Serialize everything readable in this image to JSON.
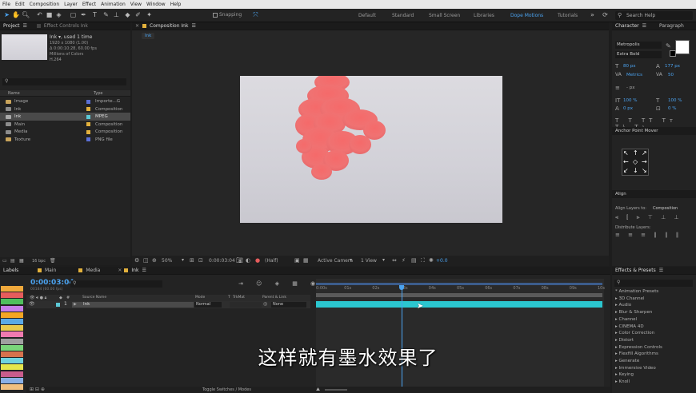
{
  "menu": [
    "File",
    "Edit",
    "Composition",
    "Layer",
    "Effect",
    "Animation",
    "View",
    "Window",
    "Help"
  ],
  "toolbar": {
    "snapping_label": "Snapping",
    "workspaces": [
      "Default",
      "Standard",
      "Small Screen",
      "Libraries",
      "Dope Motions",
      "Tutorials"
    ],
    "active_workspace": "Dope Motions",
    "search_placeholder": "Search Help"
  },
  "project": {
    "tab_label": "Project",
    "effect_controls_tab": "Effect Controls Ink",
    "selected_name": "Ink ▾, used 1 time",
    "info_lines": [
      "1920 x 1080 (1.00)",
      "Δ 0:00:10:28, 60.00 fps",
      "Millions of Colors",
      "H.264"
    ],
    "header_name": "Name",
    "header_type": "Type",
    "items": [
      {
        "name": "Image",
        "type": "Importe...G",
        "color": "#5a6fd6",
        "icon": "folder-icon",
        "icon_color": "#c9a45b"
      },
      {
        "name": "Ink",
        "type": "Composition",
        "color": "#e3b13c",
        "icon": "composition-icon",
        "icon_color": "#8c8c8c"
      },
      {
        "name": "Ink",
        "type": "MPEG",
        "color": "#5dc9d6",
        "icon": "video-icon",
        "icon_color": "#aaaaaa",
        "selected": true
      },
      {
        "name": "Main",
        "type": "Composition",
        "color": "#e3b13c",
        "icon": "composition-icon",
        "icon_color": "#8c8c8c"
      },
      {
        "name": "Media",
        "type": "Composition",
        "color": "#e3b13c",
        "icon": "composition-icon",
        "icon_color": "#8c8c8c"
      },
      {
        "name": "Texture",
        "type": "PNG file",
        "color": "#5a6fd6",
        "icon": "image-icon",
        "icon_color": "#c9a45b"
      }
    ],
    "bpc": "16 bpc"
  },
  "viewer": {
    "tab_label": "Composition Ink",
    "sub_tab": "Ink",
    "zoom": "50%",
    "timecode": "0:00:03:04",
    "resolution": "(Half)",
    "camera": "Active Camera",
    "views": "1 View",
    "exposure": "+0.0"
  },
  "character": {
    "tab_label": "Character",
    "paragraph_tab": "Paragraph",
    "font": "Metropolis",
    "style": "Extra Bold",
    "size": "80 px",
    "leading": "177 px",
    "kerning": "Metrics",
    "tracking": "50",
    "stroke_width": "- px",
    "vscale": "100 %",
    "hscale": "100 %",
    "baseline": "0 px",
    "tsume": "0 %",
    "anchor_title": "Anchor Point Mover",
    "align_tab": "Align",
    "align_to_label": "Align Layers to:",
    "align_to_value": "Composition",
    "distribute_label": "Distribute Layers:"
  },
  "effects": {
    "tab_label": "Effects & Presets",
    "items": [
      "* Animation Presets",
      "▸ 3D Channel",
      "▸ Audio",
      "▸ Blur & Sharpen",
      "▸ Channel",
      "▸ CINEMA 4D",
      "▸ Color Correction",
      "▸ Distort",
      "▸ Expression Controls",
      "▸ Flexfill Algorithms",
      "▸ Generate",
      "▸ Immersive Video",
      "▸ Keying",
      "▸ Knoll"
    ]
  },
  "labels": {
    "tab_label": "Labels",
    "swatches": [
      "#f0a93c",
      "#e65c5c",
      "#4fbf5c",
      "#c77de8",
      "#f5a623",
      "#5aa9e6",
      "#e8c94d",
      "#f07ab0",
      "#a0a0a0",
      "#7ad67a",
      "#d6724d",
      "#6fd3e0",
      "#e6e64d",
      "#c95c8c",
      "#8ab0e6",
      "#f0c080"
    ]
  },
  "timeline": {
    "tabs": [
      "Main",
      "Media",
      "Ink"
    ],
    "active_tab": "Ink",
    "timecode": "0:00:03:04",
    "timecode_sub": "00184 (60.00 fps)",
    "col_source": "Source Name",
    "col_mode": "Mode",
    "col_t": "T",
    "col_trkmat": "TrkMat",
    "col_parent": "Parent & Link",
    "layer_num": "1",
    "layer_name": "Ink",
    "layer_mode": "Normal",
    "layer_parent": "None",
    "ruler": [
      "0:00s",
      "01s",
      "02s",
      "03s",
      "04s",
      "05s",
      "06s",
      "07s",
      "08s",
      "09s",
      "10s"
    ],
    "toggle_label": "Toggle Switches / Modes",
    "playhead_fraction": 0.3,
    "subtitle": "这样就有墨水效果了"
  }
}
